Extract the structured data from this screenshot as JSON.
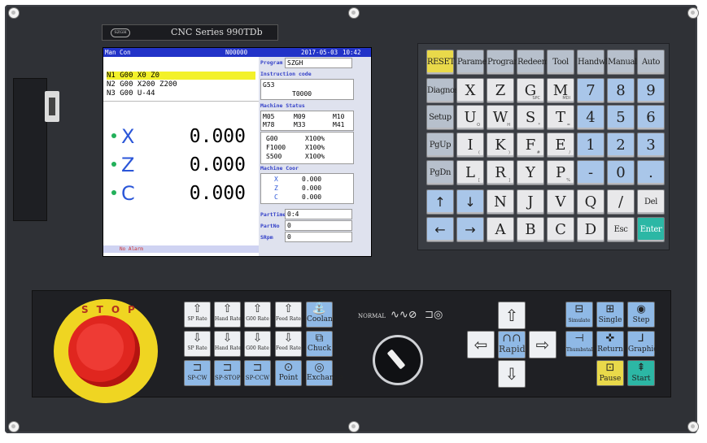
{
  "panel": {
    "title": "CNC Series 990TDb",
    "logo": "SZGH"
  },
  "screen": {
    "mode": "Man Con",
    "program_no": "N00000",
    "date": "2017-05-03",
    "time": "10:42",
    "program_lines": [
      "N1 G00 X0 Z0",
      "N2 G00 X200 Z200",
      "N3 G00 U-44"
    ],
    "axes": [
      {
        "name": "X",
        "value": "0.000"
      },
      {
        "name": "Z",
        "value": "0.000"
      },
      {
        "name": "C",
        "value": "0.000"
      }
    ],
    "alarm": "No Alarm",
    "right": {
      "program_label": "Program",
      "program_value": "SZGH",
      "instruction_label": "Instruction code",
      "instruction_line1": "G53",
      "instruction_line2": "T0000",
      "machine_status_label": "Machine Status",
      "status_row1": [
        "M05",
        "M09",
        "M10"
      ],
      "status_row2": [
        "M78",
        "M33",
        "M41"
      ],
      "rates": [
        {
          "code": "G00",
          "value": "X100%"
        },
        {
          "code": "F1000",
          "value": "X100%"
        },
        {
          "code": "S500",
          "value": "X100%"
        }
      ],
      "machine_coor_label": "Machine Coor",
      "coords": [
        {
          "axis": "X",
          "value": "0.000"
        },
        {
          "axis": "Z",
          "value": "0.000"
        },
        {
          "axis": "C",
          "value": "0.000"
        }
      ],
      "parttime_label": "PartTime",
      "parttime_value": "0:4",
      "partno_label": "PartNo",
      "partno_value": "0",
      "srpm_label": "SRpm",
      "srpm_value": "0"
    }
  },
  "keypad": {
    "row1": [
      "RESET",
      "Parameter",
      "Program",
      "Redeem",
      "Tool",
      "Handwheel",
      "Manual",
      "Auto"
    ],
    "row2": [
      "Diagnosis",
      "X",
      "Z",
      "G",
      "M",
      "7",
      "8",
      "9"
    ],
    "row2_sub": [
      "",
      "",
      "",
      "SPC",
      "MDI",
      "",
      "",
      ""
    ],
    "row3": [
      "Setup",
      "U",
      "W",
      "S",
      "T",
      "4",
      "5",
      "6"
    ],
    "row3_sub": [
      "",
      "O",
      "H",
      "*",
      "=",
      "",
      "",
      ""
    ],
    "row4": [
      "PgUp",
      "I",
      "K",
      "F",
      "E",
      "1",
      "2",
      "3"
    ],
    "row4_sub": [
      "",
      "(",
      ")",
      "#",
      "/",
      "",
      "",
      ""
    ],
    "row5": [
      "PgDn",
      "L",
      "R",
      "Y",
      "P",
      "-",
      "0",
      "."
    ],
    "row5_sub": [
      "",
      "[",
      "]",
      "",
      "%",
      "",
      "",
      ""
    ],
    "row6": [
      "↑",
      "↓",
      "N",
      "J",
      "V",
      "Q",
      "/",
      "Del"
    ],
    "row7": [
      "←",
      "→",
      "A",
      "B",
      "C",
      "D",
      "Esc",
      "Enter"
    ]
  },
  "controls": {
    "estop_label": "STOP",
    "mode_normal": "NORMAL",
    "func_row1": [
      "SP Rate",
      "Hand Rate",
      "G00 Rate",
      "Feed Rate",
      "Coolant"
    ],
    "func_row2": [
      "SP Rate",
      "Hand Rate",
      "G00 Rate",
      "Feed Rate",
      "Chuck"
    ],
    "func_row3": [
      "SP-CW",
      "SP-STOP",
      "SP-CCW",
      "Point",
      "Exchange"
    ],
    "rapid": "Rapid",
    "right_keys": [
      "Simulate",
      "Single",
      "Step",
      "Thumbstall",
      "Return",
      "Graphic",
      "Pause",
      "Start"
    ]
  },
  "colors": {
    "panel": "#2f3136",
    "screen_header": "#2233c8",
    "highlight": "#f3f12a",
    "keypad_blue": "#a9c6e9",
    "enter_teal": "#2cb7a5",
    "estop_yellow": "#efd522",
    "estop_red": "#e0261f"
  }
}
